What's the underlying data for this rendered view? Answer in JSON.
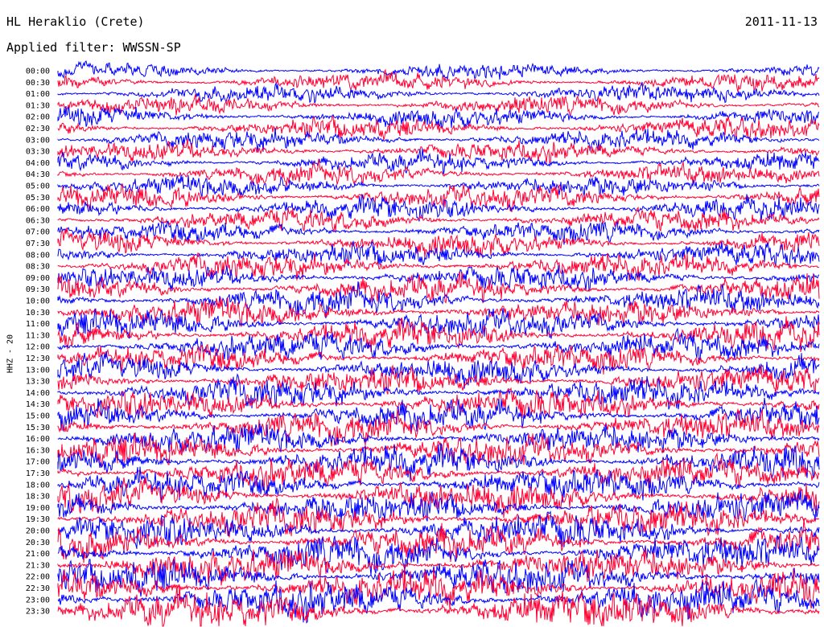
{
  "header": {
    "station": "HL Heraklio (Crete)",
    "date": "2011-11-13",
    "filter": "Applied filter: WWSSN-SP"
  },
  "chart_data": {
    "type": "line",
    "title": "HL Heraklio (Crete)",
    "ylabel": "HHZ - 20",
    "row_labels": [
      "00:00",
      "00:30",
      "01:00",
      "01:30",
      "02:00",
      "02:30",
      "03:00",
      "03:30",
      "04:00",
      "04:30",
      "05:00",
      "05:30",
      "06:00",
      "06:30",
      "07:00",
      "07:30",
      "08:00",
      "08:30",
      "09:00",
      "09:30",
      "10:00",
      "10:30",
      "11:00",
      "11:30",
      "12:00",
      "12:30",
      "13:00",
      "13:30",
      "14:00",
      "14:30",
      "15:00",
      "15:30",
      "16:00",
      "16:30",
      "17:00",
      "17:30",
      "18:00",
      "18:30",
      "19:00",
      "19:30",
      "20:00",
      "20:30",
      "21:00",
      "21:30",
      "22:00",
      "22:30",
      "23:00",
      "23:30"
    ],
    "trace_colors": [
      "#0000ff",
      "#ff0033"
    ],
    "relative_amplitude": [
      0.45,
      0.55,
      0.55,
      0.55,
      0.6,
      0.65,
      0.6,
      0.6,
      0.6,
      0.6,
      0.65,
      0.75,
      0.7,
      0.65,
      0.65,
      0.7,
      0.7,
      0.75,
      0.75,
      0.8,
      0.8,
      0.85,
      0.85,
      0.85,
      0.85,
      0.85,
      0.85,
      0.85,
      0.9,
      0.9,
      0.9,
      0.9,
      0.9,
      0.95,
      0.95,
      0.95,
      0.95,
      1.0,
      1.0,
      1.0,
      1.0,
      1.0,
      1.05,
      1.05,
      1.05,
      1.1,
      1.15,
      1.2
    ]
  }
}
